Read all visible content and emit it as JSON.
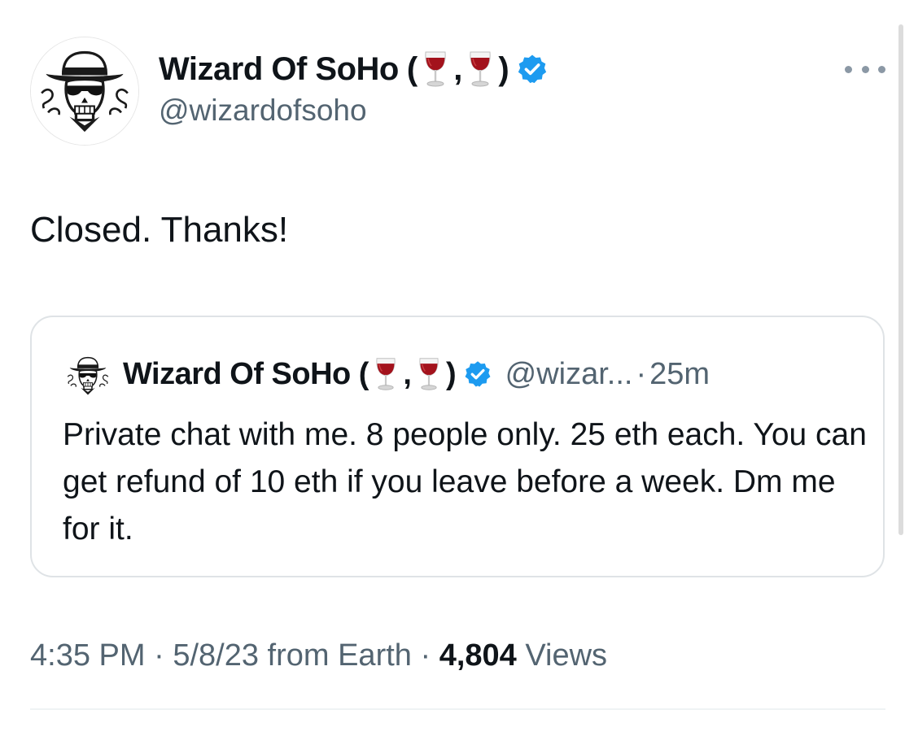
{
  "tweet": {
    "author": {
      "name": "Wizard Of SoHo",
      "name_open": "(",
      "name_comma": ",",
      "name_close": ")",
      "handle": "@wizardofsoho",
      "avatar_icon": "skull-fedora-avatar-icon",
      "verified_icon": "verified-badge-icon",
      "wine_icon": "wine-glass-icon"
    },
    "text": "Closed. Thanks!",
    "more_icon": "more-options-icon"
  },
  "quote": {
    "name": "Wizard Of SoHo",
    "name_open": "(",
    "name_comma": ",",
    "name_close": ")",
    "handle": "@wizar...",
    "separator": "·",
    "time": "25m",
    "text": "Private chat with me. 8 people only. 25 eth each. You can get refund of 10 eth if you leave before a week. Dm me for it."
  },
  "meta": {
    "time": "4:35 PM",
    "sep1": "·",
    "date": "5/8/23",
    "source": "from Earth",
    "sep2": "·",
    "views_count": "4,804",
    "views_label": "Views"
  },
  "colors": {
    "text_primary": "#0f1419",
    "text_secondary": "#536471",
    "verified_blue": "#1d9bf0",
    "wine_red": "#a3121c",
    "border": "#dfe3e6"
  }
}
